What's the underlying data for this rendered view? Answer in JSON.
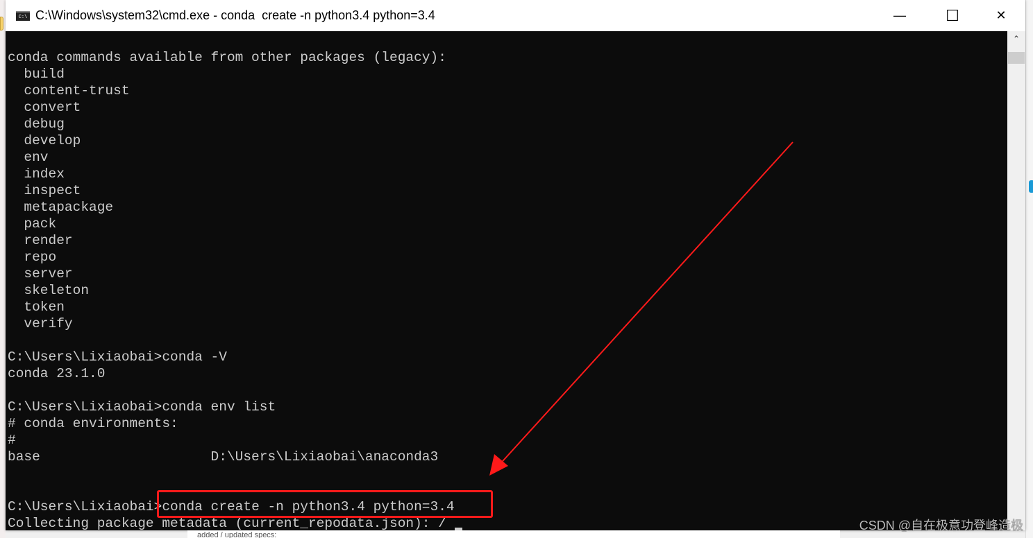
{
  "window": {
    "title": "C:\\Windows\\system32\\cmd.exe - conda  create -n python3.4 python=3.4",
    "app_icon": "cmd-icon",
    "minimize": "—",
    "maximize": "☐",
    "close": "✕"
  },
  "terminal": {
    "lines": [
      "conda commands available from other packages (legacy):",
      "  build",
      "  content-trust",
      "  convert",
      "  debug",
      "  develop",
      "  env",
      "  index",
      "  inspect",
      "  metapackage",
      "  pack",
      "  render",
      "  repo",
      "  server",
      "  skeleton",
      "  token",
      "  verify",
      "",
      "C:\\Users\\Lixiaobai>conda -V",
      "conda 23.1.0",
      "",
      "C:\\Users\\Lixiaobai>conda env list",
      "# conda environments:",
      "#",
      "base                     D:\\Users\\Lixiaobai\\anaconda3",
      "",
      ""
    ],
    "prompt": "C:\\Users\\Lixiaobai>",
    "command": "conda create -n python3.4 python=3.4",
    "progress_line": "Collecting package metadata (current_repodata.json): / "
  },
  "annotation": {
    "color": "#ff1a1a"
  },
  "background_text": "added / updated specs:",
  "watermark": "CSDN @自在极意功登峰造极",
  "colors": {
    "terminal_bg": "#0c0c0c",
    "terminal_fg": "#cccccc"
  }
}
